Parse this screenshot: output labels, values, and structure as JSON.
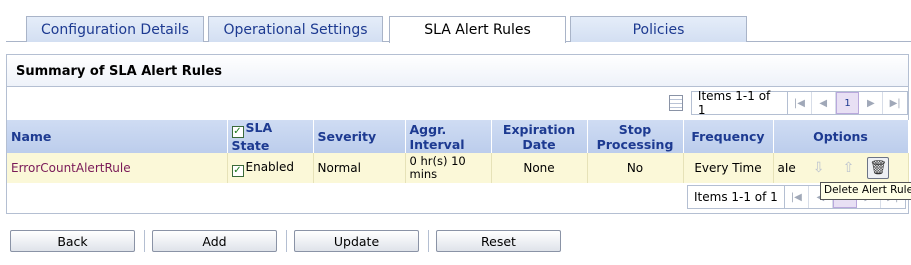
{
  "tabs": [
    "Configuration Details",
    "Operational Settings",
    "SLA Alert Rules",
    "Policies"
  ],
  "panel": {
    "title": "Summary of SLA Alert Rules"
  },
  "pager": {
    "count_text": "Items 1-1 of 1",
    "page": "1"
  },
  "table": {
    "headers": {
      "name": "Name",
      "sla_state": "SLA State",
      "severity": "Severity",
      "aggr_interval": "Aggr. Interval",
      "expiration_date": "Expiration Date",
      "stop_processing": "Stop Processing",
      "frequency": "Frequency",
      "options": "Options"
    },
    "rows": [
      {
        "name": "ErrorCountAlertRule",
        "sla_state": "Enabled",
        "severity": "Normal",
        "aggr_interval": "0 hr(s) 10 mins",
        "expiration_date": "None",
        "stop_processing": "No",
        "frequency": "Every Time",
        "options_text": "aIe"
      }
    ]
  },
  "tooltip": "Delete Alert Rule",
  "buttons": {
    "back": "Back",
    "add": "Add",
    "update": "Update",
    "reset": "Reset"
  },
  "icons": [
    "doc-icon",
    "first-page-icon",
    "prev-page-icon",
    "next-page-icon",
    "last-page-icon",
    "move-down-icon",
    "move-up-icon",
    "trash-icon",
    "checkbox-icon"
  ]
}
